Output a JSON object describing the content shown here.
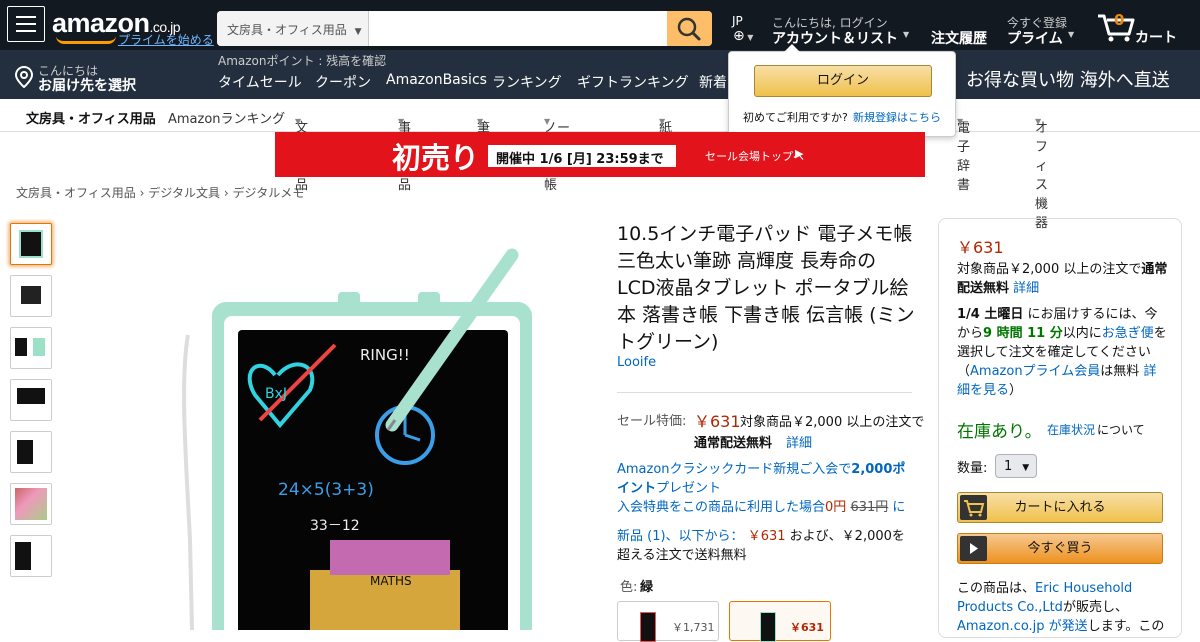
{
  "header": {
    "logo": "amazon",
    "logo_tld": ".co.jp",
    "prime_link": "プライムを始める",
    "search_category": "文房具・オフィス用品",
    "search_value": "",
    "lang": "JP",
    "greeting": "こんにちは, ログイン",
    "account": "アカウント＆リスト",
    "orders": "注文履歴",
    "prime_small": "今すぐ登録",
    "prime": "プライム",
    "cart_count": "0",
    "cart": "カート"
  },
  "nav2": {
    "deliver_small": "こんにちは",
    "deliver": "お届け先を選択",
    "points": "Amazonポイント : 残高を確認",
    "links": [
      "タイムセール",
      "クーポン",
      "AmazonBasics",
      "ランキング",
      "ギフトランキング",
      "新着"
    ],
    "promo": "お得な買い物  海外へ直送"
  },
  "popover": {
    "login": "ログイン",
    "new_text": "初めてご利用ですか?",
    "register": "新規登録はこちら"
  },
  "subnav": {
    "items": [
      "文房具・オフィス用品",
      "Amazonランキング",
      "文具・学用品",
      "事務用品",
      "筆記具",
      "ノート・メモ帳",
      "紙製品",
      "電子辞書",
      "オフィス機器"
    ]
  },
  "banner": {
    "title": "初売り",
    "period": "開催中 1/6 [月] 23:59まで",
    "link": "セール会場トップへ"
  },
  "breadcrumb": [
    "文房具・オフィス用品",
    "デジタル文具",
    "デジタルメモ"
  ],
  "product": {
    "title": "10.5インチ電子パッド 電子メモ帳 三色太い筆跡 高輝度 長寿命の LCD液晶タブレット ポータブル絵本 落書き帳 下書き帳 伝言帳 (ミントグリーン)",
    "brand": "Looife",
    "sale_label": "セール特価:",
    "price": "￥631",
    "shipping_note": "対象商品￥2,000 以上の注文で",
    "shipping_free": "通常配送無料",
    "details": "詳細",
    "card_line1a": "Amazonクラシックカード新規ご入会で",
    "card_bold": "2,000ポイント",
    "card_line1b": "プレゼント",
    "card_line2a": "入会特典をこの商品に利用した場合",
    "card_zero": "0円",
    "card_strike": "631円",
    "card_line2b": "に",
    "new_from": "新品 (1)、以下から：",
    "new_price": "￥631",
    "new_suffix": "および、￥2,000を超える注文で送料無料",
    "color_label": "色:",
    "color_value": "緑",
    "variant_prices": [
      "￥1,731",
      "￥631"
    ]
  },
  "buybox": {
    "price": "￥631",
    "ship_text": "対象商品￥2,000 以上の注文で",
    "ship_free": "通常配送無料",
    "details": "詳細",
    "date": "1/4 土曜日",
    "date_text": "にお届けするには、今から",
    "countdown": "9 時間 11 分",
    "express_prefix": "以内に",
    "express": "お急ぎ便",
    "express_suffix": "を選択して注文を確定してください（",
    "prime_member": "Amazonプライム会員",
    "free_text": "は無料",
    "more": "詳細を見る",
    "more_suffix": "）",
    "stock": "在庫あり。",
    "stock_link": "在庫状況",
    "stock_suffix": "について",
    "qty_label": "数量:",
    "qty_value": "1",
    "add_cart": "カートに入れる",
    "buy_now": "今すぐ買う",
    "seller_prefix": "この商品は、",
    "seller": "Eric Household Products Co.,Ltd",
    "seller_mid": "が販売し、",
    "ships": "Amazon.co.jp が発送",
    "ships_suffix": "します。この"
  },
  "colors": {
    "nav_dark": "#131921",
    "nav_mid": "#232f3e",
    "accent": "#febd69",
    "price": "#b12704",
    "link": "#0066c0",
    "stock": "#007600"
  }
}
